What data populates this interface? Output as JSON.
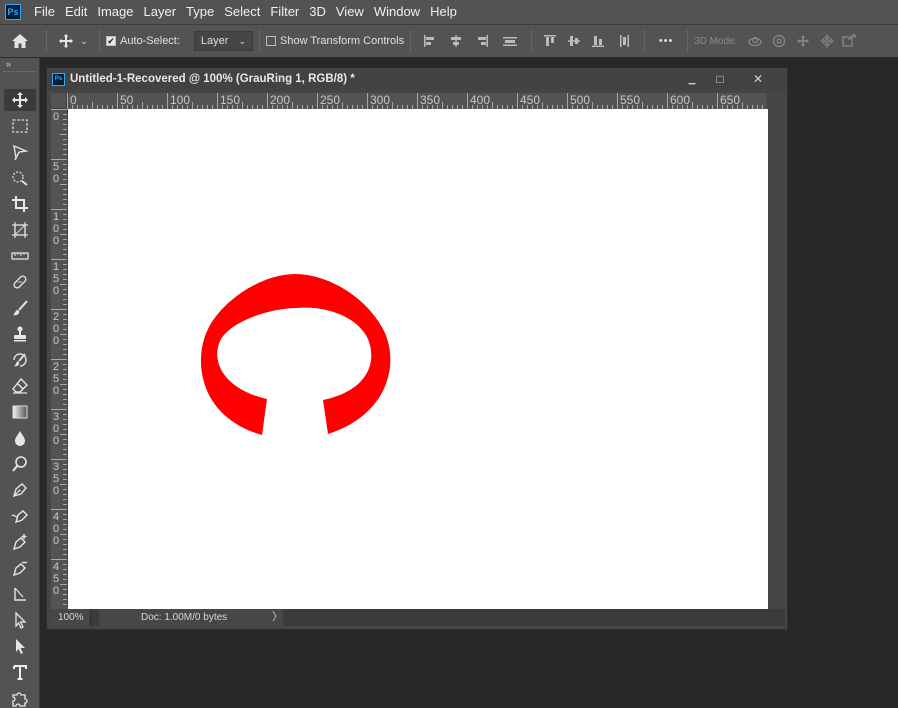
{
  "menubar": {
    "app_icon_text": "Ps",
    "items": [
      "File",
      "Edit",
      "Image",
      "Layer",
      "Type",
      "Select",
      "Filter",
      "3D",
      "View",
      "Window",
      "Help"
    ]
  },
  "options": {
    "auto_select_label": "Auto-Select:",
    "auto_select_checked": true,
    "target_value": "Layer",
    "show_transform_label": "Show Transform Controls",
    "show_transform_checked": false,
    "more_label": "•••",
    "mode_3d_label": "3D Mode:"
  },
  "tools": [
    {
      "name": "move-tool",
      "icon": "move-icon",
      "active": true
    },
    {
      "name": "marquee-tool",
      "icon": "marquee-icon"
    },
    {
      "name": "lasso-tool",
      "icon": "lasso-icon"
    },
    {
      "name": "quick-select-tool",
      "icon": "quick-select-icon"
    },
    {
      "name": "crop-tool",
      "icon": "crop-icon"
    },
    {
      "name": "frame-tool",
      "icon": "frame-icon"
    },
    {
      "name": "ruler-tool",
      "icon": "ruler-icon"
    },
    {
      "name": "healing-tool",
      "icon": "bandage-icon"
    },
    {
      "name": "brush-tool",
      "icon": "brush-icon"
    },
    {
      "name": "clone-stamp-tool",
      "icon": "stamp-icon"
    },
    {
      "name": "history-brush-tool",
      "icon": "history-brush-icon"
    },
    {
      "name": "eraser-tool",
      "icon": "eraser-icon"
    },
    {
      "name": "gradient-tool",
      "icon": "gradient-icon"
    },
    {
      "name": "blur-tool",
      "icon": "drop-icon"
    },
    {
      "name": "dodge-tool",
      "icon": "dodge-icon"
    },
    {
      "name": "pen-tool",
      "icon": "pen-icon"
    },
    {
      "name": "freeform-pen-tool",
      "icon": "freeform-pen-icon"
    },
    {
      "name": "add-anchor-tool",
      "icon": "pen-plus-icon"
    },
    {
      "name": "delete-anchor-tool",
      "icon": "pen-minus-icon"
    },
    {
      "name": "convert-point-tool",
      "icon": "convert-point-icon"
    },
    {
      "name": "path-selection-tool",
      "icon": "path-select-icon"
    },
    {
      "name": "direct-selection-tool",
      "icon": "direct-select-icon"
    },
    {
      "name": "type-tool",
      "icon": "type-icon"
    },
    {
      "name": "custom-shape-tool",
      "icon": "puzzle-icon"
    }
  ],
  "document": {
    "ps_icon_text": "Ps",
    "title": "Untitled-1-Recovered @ 100% (GrauRing 1, RGB/8) *",
    "minimize_glyph": "▁",
    "maximize_glyph": "□",
    "close_glyph": "✕",
    "zoom": "100%",
    "doc_info": "Doc: 1.00M/0 bytes",
    "status_arrow": "〉",
    "ruler_h_labels": [
      "0",
      "50",
      "100",
      "150",
      "200",
      "250",
      "300",
      "350",
      "400",
      "450",
      "500",
      "550",
      "600",
      "650"
    ],
    "ruler_v_labels": [
      "0",
      "50",
      "100",
      "150",
      "200",
      "250",
      "300",
      "350",
      "400",
      "450"
    ],
    "shape_color": "#ff0000",
    "canvas_color": "#ffffff"
  }
}
